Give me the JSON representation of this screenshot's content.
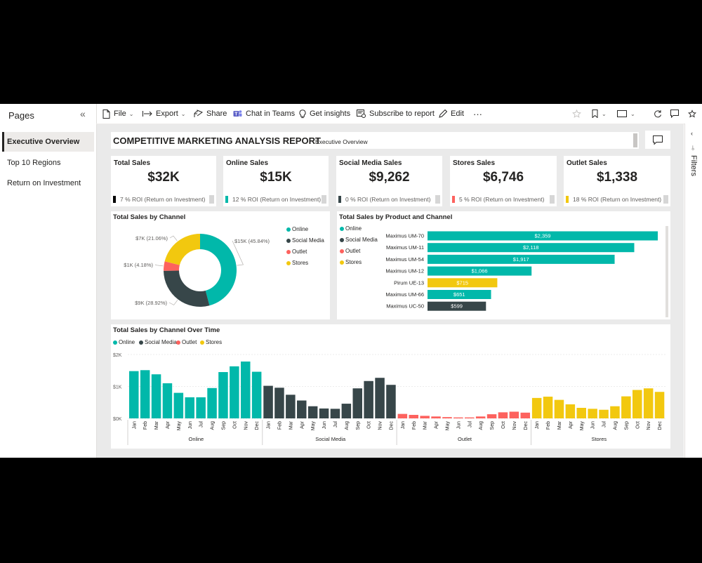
{
  "pages_pane": {
    "title": "Pages",
    "items": [
      {
        "label": "Executive Overview",
        "active": true
      },
      {
        "label": "Top 10 Regions",
        "active": false
      },
      {
        "label": "Return on Investment",
        "active": false
      }
    ]
  },
  "toolbar": {
    "file": "File",
    "export": "Export",
    "share": "Share",
    "chat": "Chat in Teams",
    "insights": "Get insights",
    "subscribe": "Subscribe to report",
    "edit": "Edit",
    "more": "···"
  },
  "filters": {
    "label": "Filters"
  },
  "report": {
    "title": "COMPETITIVE MARKETING ANALYSIS REPORT",
    "subtitle": "Executive Overview"
  },
  "kpis": [
    {
      "title": "Total Sales",
      "value": "$32K",
      "roi": "7 % ROI (Return on Investment)",
      "color": "#000000"
    },
    {
      "title": "Online Sales",
      "value": "$15K",
      "roi": "12 % ROI (Return on Investment)",
      "color": "#01B8AA"
    },
    {
      "title": "Social Media Sales",
      "value": "$9,262",
      "roi": "0 % ROI (Return on Investment)",
      "color": "#374649"
    },
    {
      "title": "Stores Sales",
      "value": "$6,746",
      "roi": "5 % ROI (Return on Investment)",
      "color": "#FD625E"
    },
    {
      "title": "Outlet Sales",
      "value": "$1,338",
      "roi": "18 % ROI (Return on Investment)",
      "color": "#F2C80F"
    }
  ],
  "colors": {
    "online": "#01B8AA",
    "social": "#374649",
    "outlet": "#FD625E",
    "stores": "#F2C80F"
  },
  "chart_data": [
    {
      "type": "pie",
      "title": "Total Sales by Channel",
      "legend": [
        "Online",
        "Social Media",
        "Outlet",
        "Stores"
      ],
      "legend_position": "top-right",
      "slices": [
        {
          "name": "Online",
          "value": 15,
          "label": "$15K (45.84%)",
          "color": "#01B8AA"
        },
        {
          "name": "Social Media",
          "value": 9,
          "label": "$9K (28.92%)",
          "color": "#374649"
        },
        {
          "name": "Outlet",
          "value": 1,
          "label": "$1K (4.18%)",
          "color": "#FD625E"
        },
        {
          "name": "Stores",
          "value": 7,
          "label": "$7K (21.06%)",
          "color": "#F2C80F"
        }
      ],
      "percentages": [
        45.84,
        28.92,
        4.18,
        21.06
      ]
    },
    {
      "type": "bar",
      "title": "Total Sales by Product and Channel",
      "legend": [
        "Online",
        "Social Media",
        "Outlet",
        "Stores"
      ],
      "legend_position": "top-left",
      "orientation": "horizontal",
      "bars": [
        {
          "category": "Maximus UM-70",
          "value": 2359,
          "label": "$2,359",
          "series": "Online"
        },
        {
          "category": "Maximus UM-11",
          "value": 2118,
          "label": "$2,118",
          "series": "Online"
        },
        {
          "category": "Maximus UM-54",
          "value": 1917,
          "label": "$1,917",
          "series": "Online"
        },
        {
          "category": "Maximus UM-12",
          "value": 1066,
          "label": "$1,066",
          "series": "Online"
        },
        {
          "category": "Pirum UE-13",
          "value": 715,
          "label": "$715",
          "series": "Stores"
        },
        {
          "category": "Maximus UM-66",
          "value": 651,
          "label": "$651",
          "series": "Online"
        },
        {
          "category": "Maximus UC-50",
          "value": 599,
          "label": "$599",
          "series": "Social Media"
        }
      ]
    },
    {
      "type": "bar",
      "title": "Total Sales by Channel Over Time",
      "legend": [
        "Online",
        "Social Media",
        "Outlet",
        "Stores"
      ],
      "legend_position": "top-left",
      "y_ticks": [
        "$2K",
        "$1K",
        "$0K"
      ],
      "ylim": [
        0,
        2000
      ],
      "months": [
        "Jan",
        "Feb",
        "Mar",
        "Apr",
        "May",
        "Jun",
        "Jul",
        "Aug",
        "Sep",
        "Oct",
        "Nov",
        "Dec"
      ],
      "groups": [
        {
          "name": "Online",
          "color": "#01B8AA",
          "values": [
            1480,
            1510,
            1380,
            1100,
            800,
            660,
            660,
            950,
            1450,
            1630,
            1780,
            1460
          ]
        },
        {
          "name": "Social Media",
          "color": "#374649",
          "values": [
            1020,
            960,
            740,
            560,
            380,
            310,
            300,
            460,
            940,
            1170,
            1270,
            1050
          ]
        },
        {
          "name": "Outlet",
          "color": "#FD625E",
          "values": [
            140,
            110,
            80,
            60,
            40,
            30,
            30,
            60,
            130,
            190,
            210,
            180
          ]
        },
        {
          "name": "Stores",
          "color": "#F2C80F",
          "values": [
            640,
            680,
            580,
            440,
            330,
            300,
            270,
            380,
            690,
            890,
            940,
            830
          ]
        }
      ]
    }
  ]
}
